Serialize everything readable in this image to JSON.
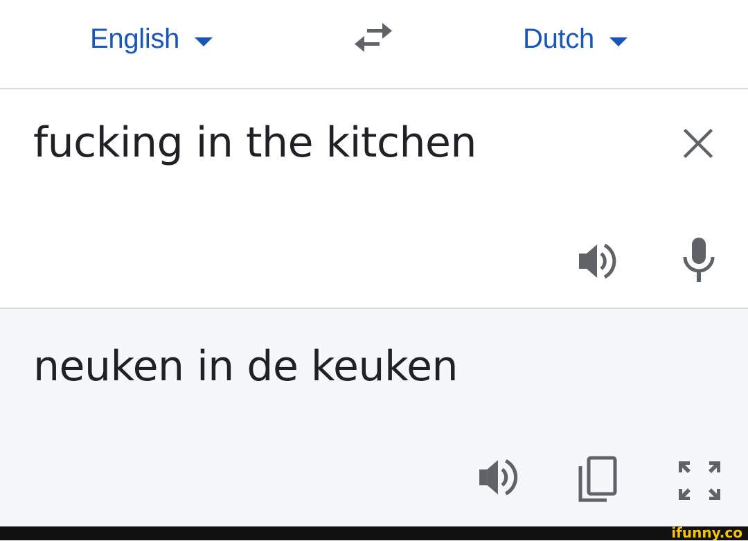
{
  "language_bar": {
    "source_language": "English",
    "target_language": "Dutch",
    "swap_icon": "swap-horiz-icon",
    "dropdown_icon": "arrow-drop-down-icon"
  },
  "input": {
    "text": "fucking in the kitchen",
    "icons": [
      "close-icon",
      "volume-up-icon",
      "mic-icon"
    ]
  },
  "output": {
    "text": "neuken in de keuken",
    "icons": [
      "volume-up-icon",
      "copy-icon",
      "fullscreen-icon"
    ]
  },
  "watermark": {
    "text": "ifunny.co"
  },
  "colors": {
    "accent": "#1a56b5",
    "icon": "#5f6368",
    "text": "#202124",
    "output_bg": "#f6f7fa",
    "divider": "#dadce0",
    "watermark": "#f6c400"
  }
}
